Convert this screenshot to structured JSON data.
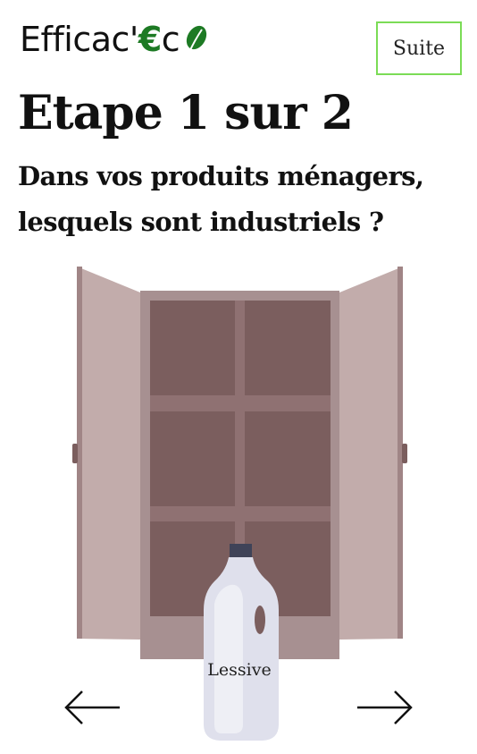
{
  "brand": {
    "prefix": "Efficac'",
    "euro": "€",
    "suffix": "c"
  },
  "header": {
    "next_label": "Suite"
  },
  "step": {
    "title": "Etape 1 sur 2",
    "question": "Dans vos produits ménagers, lesquels sont industriels ?"
  },
  "illustration": {
    "product_label": "Lessive",
    "colors": {
      "door": "#c2acab",
      "door_edge": "#a08586",
      "frame": "#a79091",
      "shelf_back": "#7b5e5e",
      "bottle": "#dfe0ec",
      "bottle_cap": "#3f4358"
    }
  },
  "navigation": {
    "previous_icon": "arrow-left-icon",
    "next_icon": "arrow-right-icon"
  },
  "colors": {
    "accent": "#7bdc56",
    "brand_green": "#1d7a24"
  }
}
